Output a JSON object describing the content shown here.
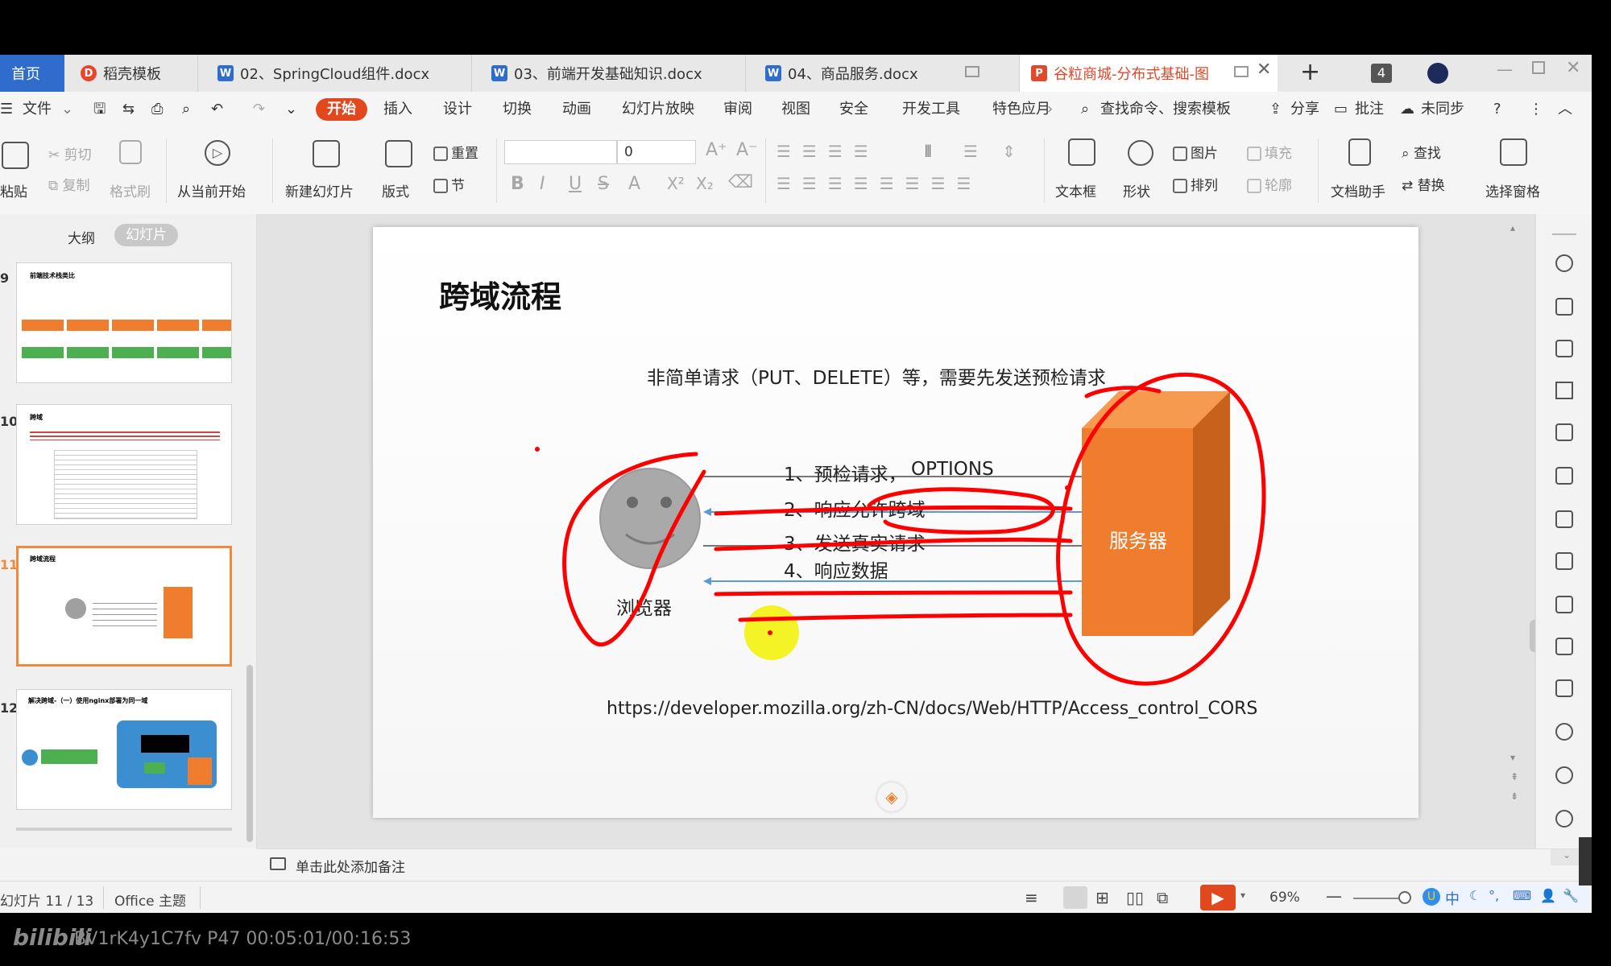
{
  "tabs": [
    {
      "label": "首页",
      "icon": "home-tab"
    },
    {
      "label": "稻壳模板",
      "icon": "docer-icon"
    },
    {
      "label": "02、SpringCloud组件.docx",
      "icon": "word-icon"
    },
    {
      "label": "03、前端开发基础知识.docx",
      "icon": "word-icon"
    },
    {
      "label": "04、商品服务.docx",
      "icon": "word-icon"
    },
    {
      "label": "谷粒商城-分布式基础-图",
      "icon": "ppt-icon"
    }
  ],
  "tab_count": "4",
  "menu": {
    "file": "文件",
    "items": [
      "开始",
      "插入",
      "设计",
      "切换",
      "动画",
      "幻灯片放映",
      "审阅",
      "视图",
      "安全",
      "开发工具",
      "特色应月"
    ],
    "search": "查找命令、搜索模板",
    "share": "分享",
    "comment": "批注",
    "sync": "未同步"
  },
  "toolbar": {
    "paste": "粘贴",
    "cut": "剪切",
    "copy": "复制",
    "format_painter": "格式刷",
    "from_current": "从当前开始",
    "new_slide": "新建幻灯片",
    "layout": "版式",
    "reset": "重置",
    "section": "节",
    "font_size": "0",
    "textbox": "文本框",
    "shape": "形状",
    "picture": "图片",
    "arrange": "排列",
    "fill": "填充",
    "outline": "轮廓",
    "doc_assistant": "文档助手",
    "find": "查找",
    "replace": "替换",
    "select_pane": "选择窗格"
  },
  "panel": {
    "outline_tab": "大纲",
    "slides_tab": "幻灯片",
    "slide_numbers": [
      "9",
      "10",
      "11",
      "12"
    ],
    "thumb_titles": [
      "前端技术栈类比",
      "跨域",
      "跨域流程",
      "解决跨域-（一）使用nginx部署为同一域"
    ]
  },
  "slide": {
    "title": "跨域流程",
    "subtitle": "非简单请求（PUT、DELETE）等，需要先发送预检请求",
    "steps": [
      "1、预检请求，",
      "2、响应允许跨域",
      "3、发送真实请求",
      "4、响应数据"
    ],
    "options": "OPTIONS",
    "browser": "浏览器",
    "server": "服务器",
    "url": "https://developer.mozilla.org/zh-CN/docs/Web/HTTP/Access_control_CORS"
  },
  "notes": "单击此处添加备注",
  "status": {
    "slide_pos": "幻灯片 11 / 13",
    "theme": "Office 主题",
    "zoom": "69%",
    "ime": "中"
  },
  "video": {
    "brand": "bilibili",
    "info": "BV1rK4y1C7fv P47 00:05:01/00:16:53"
  },
  "colors": {
    "accent": "#e2481e",
    "server_orange": "#ef7d2d",
    "annotation_red": "#ff0000",
    "home_blue": "#2f6ccc"
  }
}
